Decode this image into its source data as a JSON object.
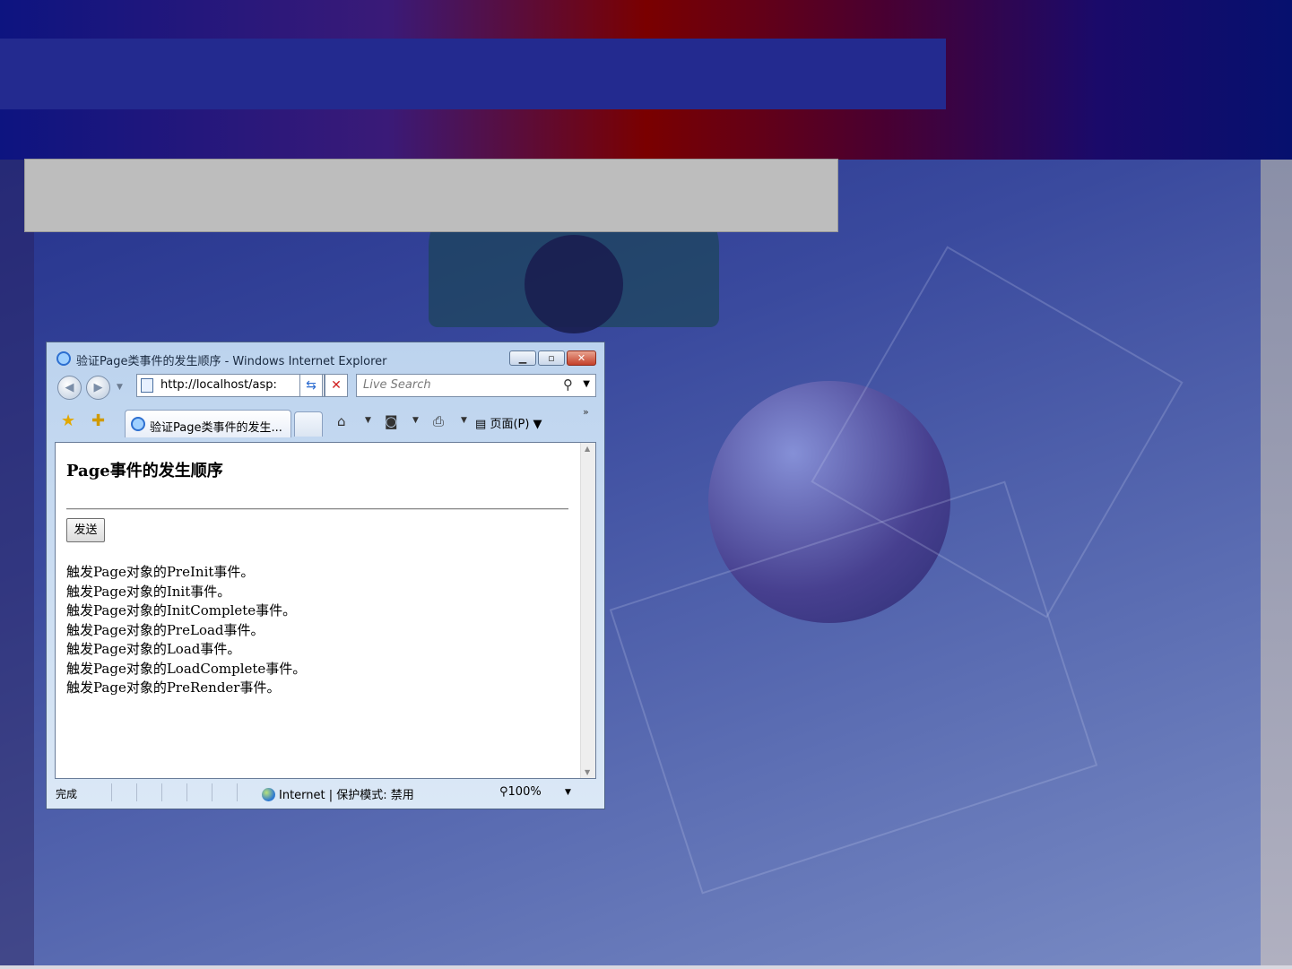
{
  "browser": {
    "window_title": "验证Page类事件的发生顺序 - Windows Internet Explorer",
    "address_url": "http://localhost/asp:",
    "search_placeholder": "Live Search",
    "tab_label": "验证Page类事件的发生...",
    "page_menu_label": "页面(P)",
    "status_text": "完成",
    "zone_text": "Internet | 保护模式: 禁用",
    "zoom_text": "100%"
  },
  "page": {
    "heading": "Page事件的发生顺序",
    "send_button_label": "发送",
    "events": [
      "触发Page对象的PreInit事件。",
      "触发Page对象的Init事件。",
      "触发Page对象的InitComplete事件。",
      "触发Page对象的PreLoad事件。",
      "触发Page对象的Load事件。",
      "触发Page对象的LoadComplete事件。",
      "触发Page对象的PreRender事件。"
    ]
  },
  "icons": {
    "back": "back-arrow-icon",
    "forward": "forward-arrow-icon",
    "refresh": "refresh-icon",
    "stop": "stop-icon",
    "search": "magnifier-icon",
    "favorites": "star-icon",
    "add_favorites": "add-favorite-icon",
    "home": "home-icon",
    "feeds": "rss-icon",
    "print": "printer-icon",
    "page": "page-icon",
    "globe": "globe-icon",
    "zoom": "zoom-icon"
  },
  "colors": {
    "slide_header_red": "#7a0000",
    "slide_header_blue": "#232a8f",
    "gray_banner": "#bdbdbd"
  }
}
